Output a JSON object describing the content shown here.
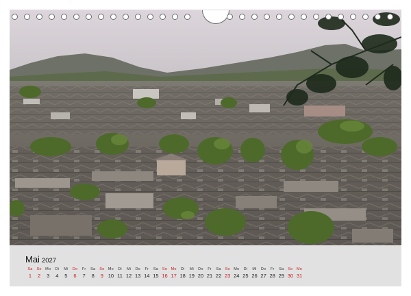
{
  "calendar": {
    "month": "Mai",
    "year": "2027",
    "days": [
      {
        "dn": "Sa",
        "num": "1",
        "we": true
      },
      {
        "dn": "So",
        "num": "2",
        "we": true
      },
      {
        "dn": "Mo",
        "num": "3",
        "we": false
      },
      {
        "dn": "Di",
        "num": "4",
        "we": false
      },
      {
        "dn": "Mi",
        "num": "5",
        "we": false
      },
      {
        "dn": "Do",
        "num": "6",
        "we": true
      },
      {
        "dn": "Fr",
        "num": "7",
        "we": false
      },
      {
        "dn": "Sa",
        "num": "8",
        "we": false
      },
      {
        "dn": "So",
        "num": "9",
        "we": true
      },
      {
        "dn": "Mo",
        "num": "10",
        "we": false
      },
      {
        "dn": "Di",
        "num": "11",
        "we": false
      },
      {
        "dn": "Mi",
        "num": "12",
        "we": false
      },
      {
        "dn": "Do",
        "num": "13",
        "we": false
      },
      {
        "dn": "Fr",
        "num": "14",
        "we": false
      },
      {
        "dn": "Sa",
        "num": "15",
        "we": false
      },
      {
        "dn": "So",
        "num": "16",
        "we": true
      },
      {
        "dn": "Mo",
        "num": "17",
        "we": true
      },
      {
        "dn": "Di",
        "num": "18",
        "we": false
      },
      {
        "dn": "Mi",
        "num": "19",
        "we": false
      },
      {
        "dn": "Do",
        "num": "20",
        "we": false
      },
      {
        "dn": "Fr",
        "num": "21",
        "we": false
      },
      {
        "dn": "Sa",
        "num": "22",
        "we": false
      },
      {
        "dn": "So",
        "num": "23",
        "we": true
      },
      {
        "dn": "Mo",
        "num": "24",
        "we": false
      },
      {
        "dn": "Di",
        "num": "25",
        "we": false
      },
      {
        "dn": "Mi",
        "num": "26",
        "we": false
      },
      {
        "dn": "Do",
        "num": "27",
        "we": false
      },
      {
        "dn": "Fr",
        "num": "28",
        "we": false
      },
      {
        "dn": "Sa",
        "num": "29",
        "we": false
      },
      {
        "dn": "So",
        "num": "30",
        "we": true
      },
      {
        "dn": "Mo",
        "num": "31",
        "we": true
      }
    ]
  },
  "colors": {
    "sky": "#cfc9cf",
    "hills": "#6f7268",
    "roofs": "#6b655f",
    "trees": "#4f6a2c",
    "weekend": "#c8191e",
    "calendar_bar": "#e1e1e1"
  }
}
